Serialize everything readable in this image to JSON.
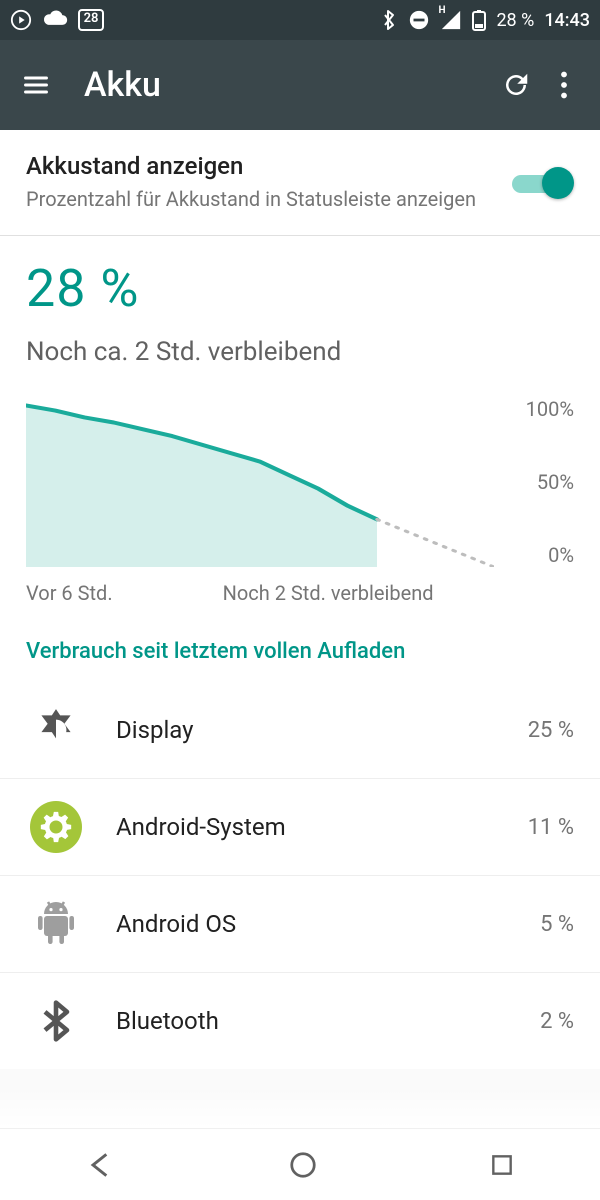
{
  "status_bar": {
    "battery_pct": "28 %",
    "time": "14:43",
    "calendar_badge": "28"
  },
  "app_bar": {
    "title": "Akku"
  },
  "toggle": {
    "title": "Akkustand anzeigen",
    "subtitle": "Prozentzahl für Akkustand in Statusleiste anzeigen",
    "on": true
  },
  "summary": {
    "percent": "28 %",
    "remaining": "Noch ca. 2 Std. verbleibend"
  },
  "chart_data": {
    "type": "area",
    "x": [
      0,
      0.5,
      1,
      1.5,
      2,
      2.5,
      3,
      3.5,
      4,
      4.5,
      5,
      5.5,
      6
    ],
    "values": [
      95,
      92,
      88,
      85,
      81,
      77,
      72,
      67,
      62,
      54,
      46,
      36,
      28
    ],
    "projection_x": [
      6,
      8
    ],
    "projection_values": [
      28,
      0
    ],
    "ylim": [
      0,
      100
    ],
    "ylabels": [
      "100%",
      "50%",
      "0%"
    ],
    "xlabel_left": "Vor 6 Std.",
    "xlabel_right": "Noch 2 Std. verbleibend",
    "line_color": "#1aab9b",
    "fill_color": "#d5efeb"
  },
  "usage_header": "Verbrauch seit letztem vollen Aufladen",
  "usage": [
    {
      "icon": "brightness",
      "label": "Display",
      "pct": "25 %"
    },
    {
      "icon": "gear",
      "label": "Android-System",
      "pct": "11 %"
    },
    {
      "icon": "android",
      "label": "Android OS",
      "pct": "5 %"
    },
    {
      "icon": "bluetooth",
      "label": "Bluetooth",
      "pct": "2 %"
    }
  ],
  "colors": {
    "accent": "#009688",
    "android_green": "#a4c639",
    "text_secondary": "#757575"
  }
}
